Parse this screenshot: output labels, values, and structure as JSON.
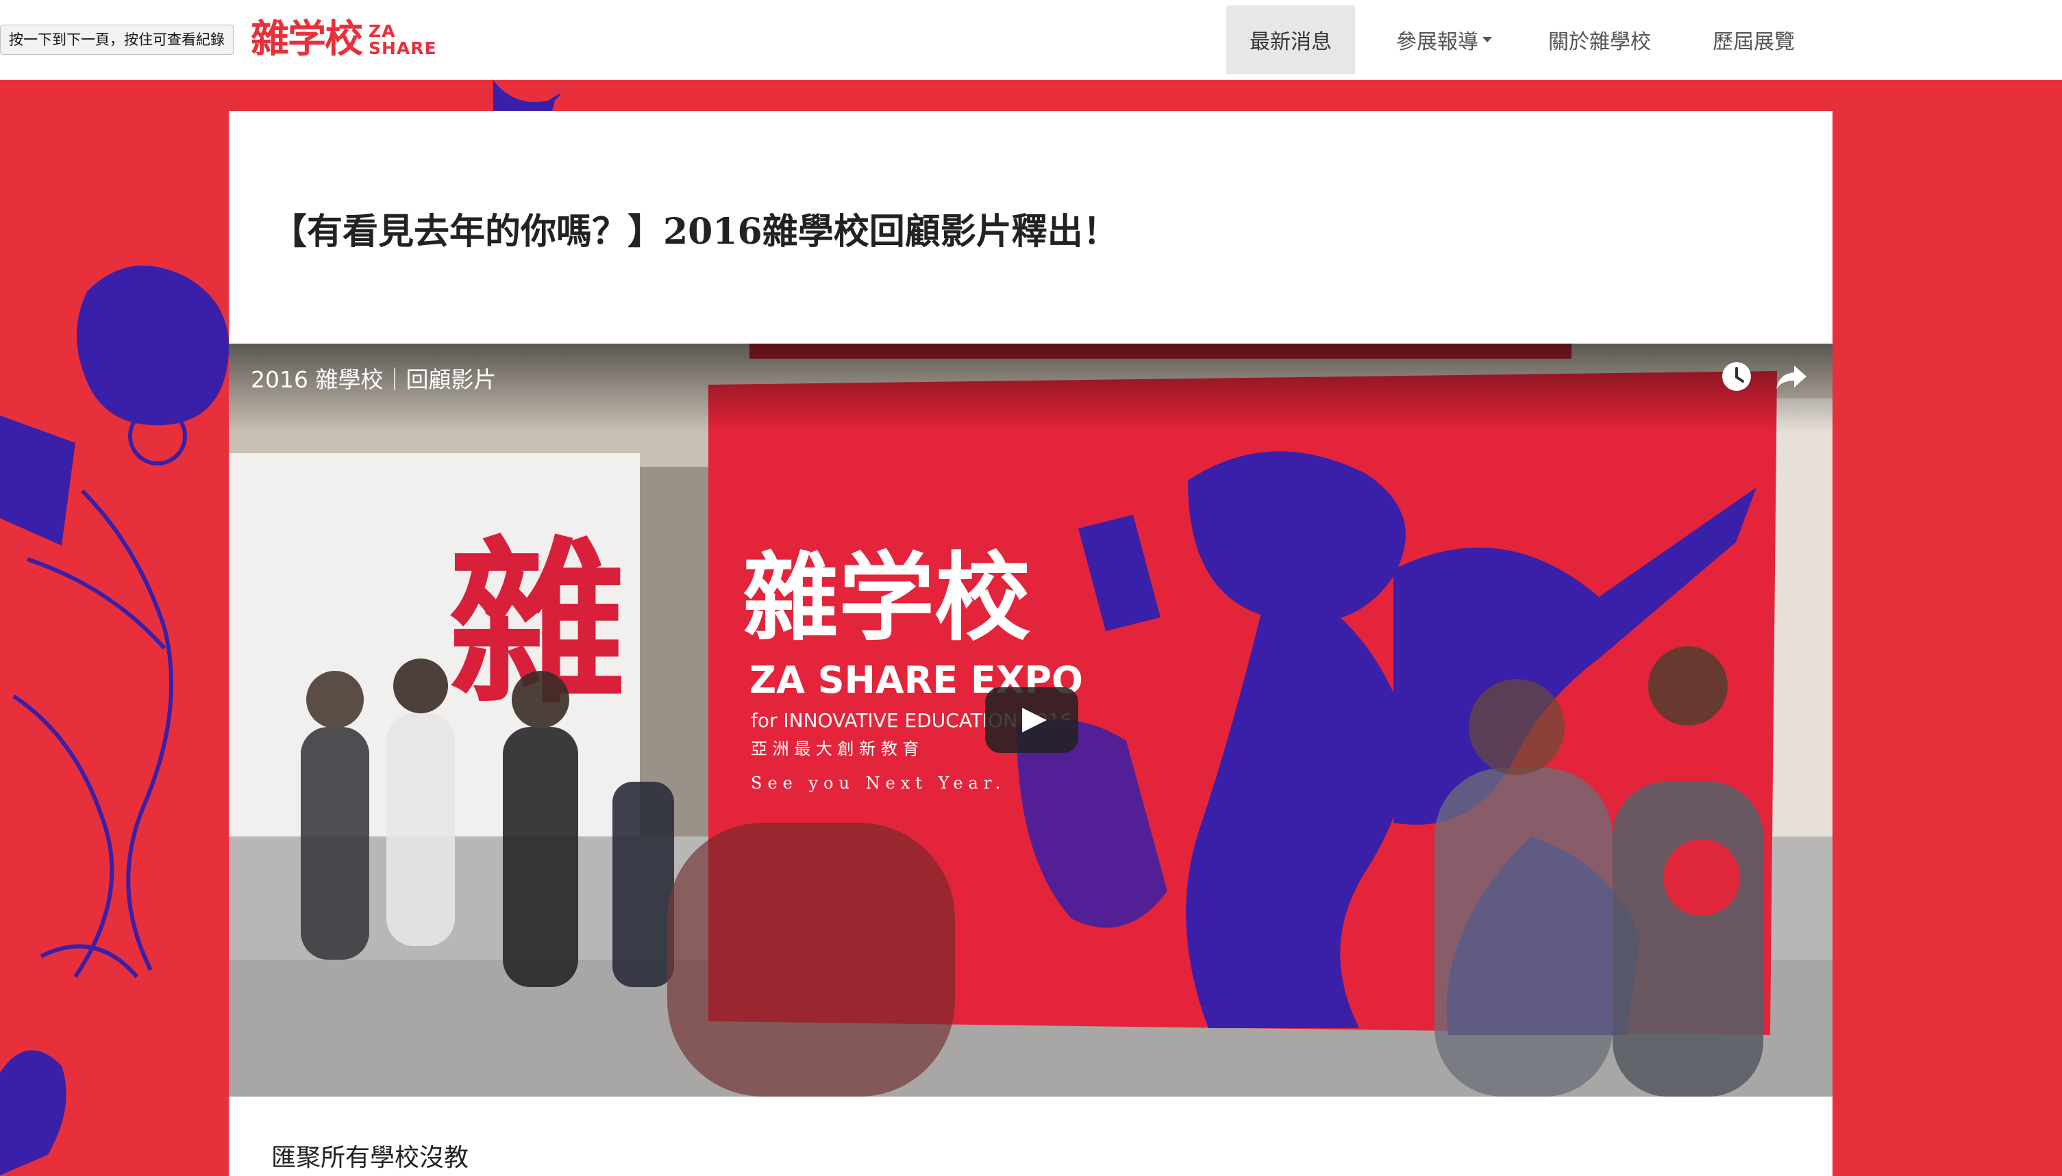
{
  "browser": {
    "tooltip": "按一下到下一頁，按住可查看紀錄"
  },
  "header": {
    "logo_cn": "雜学校",
    "logo_en_line1": "ZA",
    "logo_en_line2": "SHARE",
    "brand_color": "#e8303c",
    "nav": [
      {
        "label": "最新消息",
        "active": true
      },
      {
        "label": "參展報導",
        "dropdown": true
      },
      {
        "label": "關於雜學校"
      },
      {
        "label": "歷屆展覽"
      }
    ]
  },
  "article": {
    "title": "【有看見去年的你嗎？】2016雜學校回顧影片釋出！",
    "video": {
      "title": "2016 雜學校｜回顧影片",
      "icons": [
        "watch-later-icon",
        "share-icon",
        "play-icon"
      ],
      "poster": {
        "wall_text": "雜",
        "banner_title": "雜学校",
        "banner_subtitle": "ZA SHARE EXPO",
        "banner_line": "for INNOVATIVE EDUCATION 2016",
        "banner_cn": "亞 洲 最 大 創 新 教 育",
        "banner_tagline": "See you Next Year."
      }
    },
    "body_first_line": "匯聚所有學校沒教"
  }
}
